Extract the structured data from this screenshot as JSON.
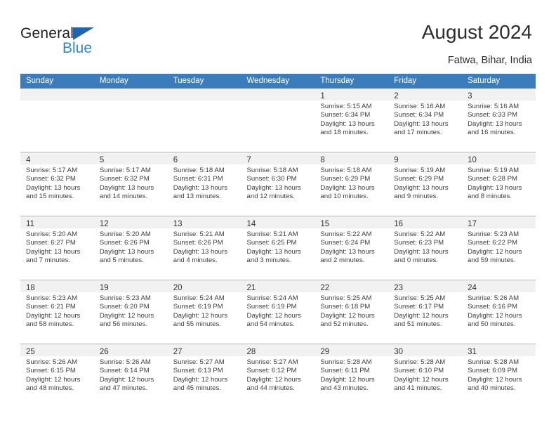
{
  "brand": {
    "name_top": "General",
    "name_bottom": "Blue"
  },
  "header": {
    "title": "August 2024",
    "location": "Fatwa, Bihar, India"
  },
  "colors": {
    "header_blue": "#3b7cbd",
    "brand_blue": "#2e86d4",
    "logo_triangle": "#1f66b0",
    "daynum_band": "#f1f1f1",
    "row_divider": "#b8b8b8",
    "text": "#3d3d3d"
  },
  "weekdays": [
    "Sunday",
    "Monday",
    "Tuesday",
    "Wednesday",
    "Thursday",
    "Friday",
    "Saturday"
  ],
  "labels": {
    "sunrise": "Sunrise:",
    "sunset": "Sunset:",
    "daylight": "Daylight:"
  },
  "days": [
    {
      "day": "",
      "lines": []
    },
    {
      "day": "",
      "lines": []
    },
    {
      "day": "",
      "lines": []
    },
    {
      "day": "",
      "lines": []
    },
    {
      "day": "1",
      "lines": [
        "Sunrise: 5:15 AM",
        "Sunset: 6:34 PM",
        "Daylight: 13 hours",
        "and 18 minutes."
      ]
    },
    {
      "day": "2",
      "lines": [
        "Sunrise: 5:16 AM",
        "Sunset: 6:34 PM",
        "Daylight: 13 hours",
        "and 17 minutes."
      ]
    },
    {
      "day": "3",
      "lines": [
        "Sunrise: 5:16 AM",
        "Sunset: 6:33 PM",
        "Daylight: 13 hours",
        "and 16 minutes."
      ]
    },
    {
      "day": "4",
      "lines": [
        "Sunrise: 5:17 AM",
        "Sunset: 6:32 PM",
        "Daylight: 13 hours",
        "and 15 minutes."
      ]
    },
    {
      "day": "5",
      "lines": [
        "Sunrise: 5:17 AM",
        "Sunset: 6:32 PM",
        "Daylight: 13 hours",
        "and 14 minutes."
      ]
    },
    {
      "day": "6",
      "lines": [
        "Sunrise: 5:18 AM",
        "Sunset: 6:31 PM",
        "Daylight: 13 hours",
        "and 13 minutes."
      ]
    },
    {
      "day": "7",
      "lines": [
        "Sunrise: 5:18 AM",
        "Sunset: 6:30 PM",
        "Daylight: 13 hours",
        "and 12 minutes."
      ]
    },
    {
      "day": "8",
      "lines": [
        "Sunrise: 5:18 AM",
        "Sunset: 6:29 PM",
        "Daylight: 13 hours",
        "and 10 minutes."
      ]
    },
    {
      "day": "9",
      "lines": [
        "Sunrise: 5:19 AM",
        "Sunset: 6:29 PM",
        "Daylight: 13 hours",
        "and 9 minutes."
      ]
    },
    {
      "day": "10",
      "lines": [
        "Sunrise: 5:19 AM",
        "Sunset: 6:28 PM",
        "Daylight: 13 hours",
        "and 8 minutes."
      ]
    },
    {
      "day": "11",
      "lines": [
        "Sunrise: 5:20 AM",
        "Sunset: 6:27 PM",
        "Daylight: 13 hours",
        "and 7 minutes."
      ]
    },
    {
      "day": "12",
      "lines": [
        "Sunrise: 5:20 AM",
        "Sunset: 6:26 PM",
        "Daylight: 13 hours",
        "and 5 minutes."
      ]
    },
    {
      "day": "13",
      "lines": [
        "Sunrise: 5:21 AM",
        "Sunset: 6:26 PM",
        "Daylight: 13 hours",
        "and 4 minutes."
      ]
    },
    {
      "day": "14",
      "lines": [
        "Sunrise: 5:21 AM",
        "Sunset: 6:25 PM",
        "Daylight: 13 hours",
        "and 3 minutes."
      ]
    },
    {
      "day": "15",
      "lines": [
        "Sunrise: 5:22 AM",
        "Sunset: 6:24 PM",
        "Daylight: 13 hours",
        "and 2 minutes."
      ]
    },
    {
      "day": "16",
      "lines": [
        "Sunrise: 5:22 AM",
        "Sunset: 6:23 PM",
        "Daylight: 13 hours",
        "and 0 minutes."
      ]
    },
    {
      "day": "17",
      "lines": [
        "Sunrise: 5:23 AM",
        "Sunset: 6:22 PM",
        "Daylight: 12 hours",
        "and 59 minutes."
      ]
    },
    {
      "day": "18",
      "lines": [
        "Sunrise: 5:23 AM",
        "Sunset: 6:21 PM",
        "Daylight: 12 hours",
        "and 58 minutes."
      ]
    },
    {
      "day": "19",
      "lines": [
        "Sunrise: 5:23 AM",
        "Sunset: 6:20 PM",
        "Daylight: 12 hours",
        "and 56 minutes."
      ]
    },
    {
      "day": "20",
      "lines": [
        "Sunrise: 5:24 AM",
        "Sunset: 6:19 PM",
        "Daylight: 12 hours",
        "and 55 minutes."
      ]
    },
    {
      "day": "21",
      "lines": [
        "Sunrise: 5:24 AM",
        "Sunset: 6:19 PM",
        "Daylight: 12 hours",
        "and 54 minutes."
      ]
    },
    {
      "day": "22",
      "lines": [
        "Sunrise: 5:25 AM",
        "Sunset: 6:18 PM",
        "Daylight: 12 hours",
        "and 52 minutes."
      ]
    },
    {
      "day": "23",
      "lines": [
        "Sunrise: 5:25 AM",
        "Sunset: 6:17 PM",
        "Daylight: 12 hours",
        "and 51 minutes."
      ]
    },
    {
      "day": "24",
      "lines": [
        "Sunrise: 5:26 AM",
        "Sunset: 6:16 PM",
        "Daylight: 12 hours",
        "and 50 minutes."
      ]
    },
    {
      "day": "25",
      "lines": [
        "Sunrise: 5:26 AM",
        "Sunset: 6:15 PM",
        "Daylight: 12 hours",
        "and 48 minutes."
      ]
    },
    {
      "day": "26",
      "lines": [
        "Sunrise: 5:26 AM",
        "Sunset: 6:14 PM",
        "Daylight: 12 hours",
        "and 47 minutes."
      ]
    },
    {
      "day": "27",
      "lines": [
        "Sunrise: 5:27 AM",
        "Sunset: 6:13 PM",
        "Daylight: 12 hours",
        "and 45 minutes."
      ]
    },
    {
      "day": "28",
      "lines": [
        "Sunrise: 5:27 AM",
        "Sunset: 6:12 PM",
        "Daylight: 12 hours",
        "and 44 minutes."
      ]
    },
    {
      "day": "29",
      "lines": [
        "Sunrise: 5:28 AM",
        "Sunset: 6:11 PM",
        "Daylight: 12 hours",
        "and 43 minutes."
      ]
    },
    {
      "day": "30",
      "lines": [
        "Sunrise: 5:28 AM",
        "Sunset: 6:10 PM",
        "Daylight: 12 hours",
        "and 41 minutes."
      ]
    },
    {
      "day": "31",
      "lines": [
        "Sunrise: 5:28 AM",
        "Sunset: 6:09 PM",
        "Daylight: 12 hours",
        "and 40 minutes."
      ]
    }
  ]
}
